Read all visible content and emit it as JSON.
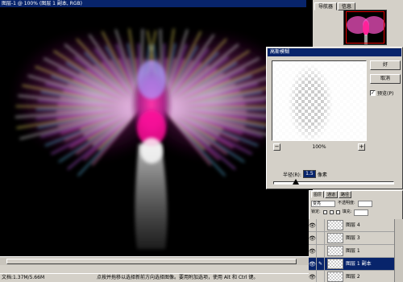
{
  "document": {
    "title": "图层-1 @ 100% (图层 1 副本, RGB)"
  },
  "navigator": {
    "tabs": [
      "导航器",
      "信息"
    ]
  },
  "dialog": {
    "title": "高斯模糊",
    "ok_label": "好",
    "cancel_label": "取消",
    "preview_label": "预览(P)",
    "preview_checked": true,
    "zoom_level": "100%",
    "radius_label": "半径(R):",
    "radius_value": "1.5",
    "radius_unit": "像素"
  },
  "layers": {
    "tabs": [
      "图层",
      "通道",
      "路径"
    ],
    "blend_mode": "变亮",
    "opacity_label": "不透明度:",
    "lock_label": "锁定:",
    "fill_label": "填充:",
    "items": [
      {
        "name": "图层 4",
        "visible": true,
        "selected": false
      },
      {
        "name": "图层 3",
        "visible": true,
        "selected": false
      },
      {
        "name": "图层 1",
        "visible": true,
        "selected": false
      },
      {
        "name": "图层 1 副本",
        "visible": true,
        "selected": true
      },
      {
        "name": "图层 2",
        "visible": true,
        "selected": false
      }
    ]
  },
  "status": {
    "doc_size": "文档:1.37M/5.66M",
    "hint": "点按并拖移以选择新前方向选择图像。要用附加选项，使用 Alt 和 Ctrl 键。"
  },
  "colors": {
    "titlebar": "#08246b",
    "panel": "#d4d0c8",
    "selection": "#08246b"
  }
}
